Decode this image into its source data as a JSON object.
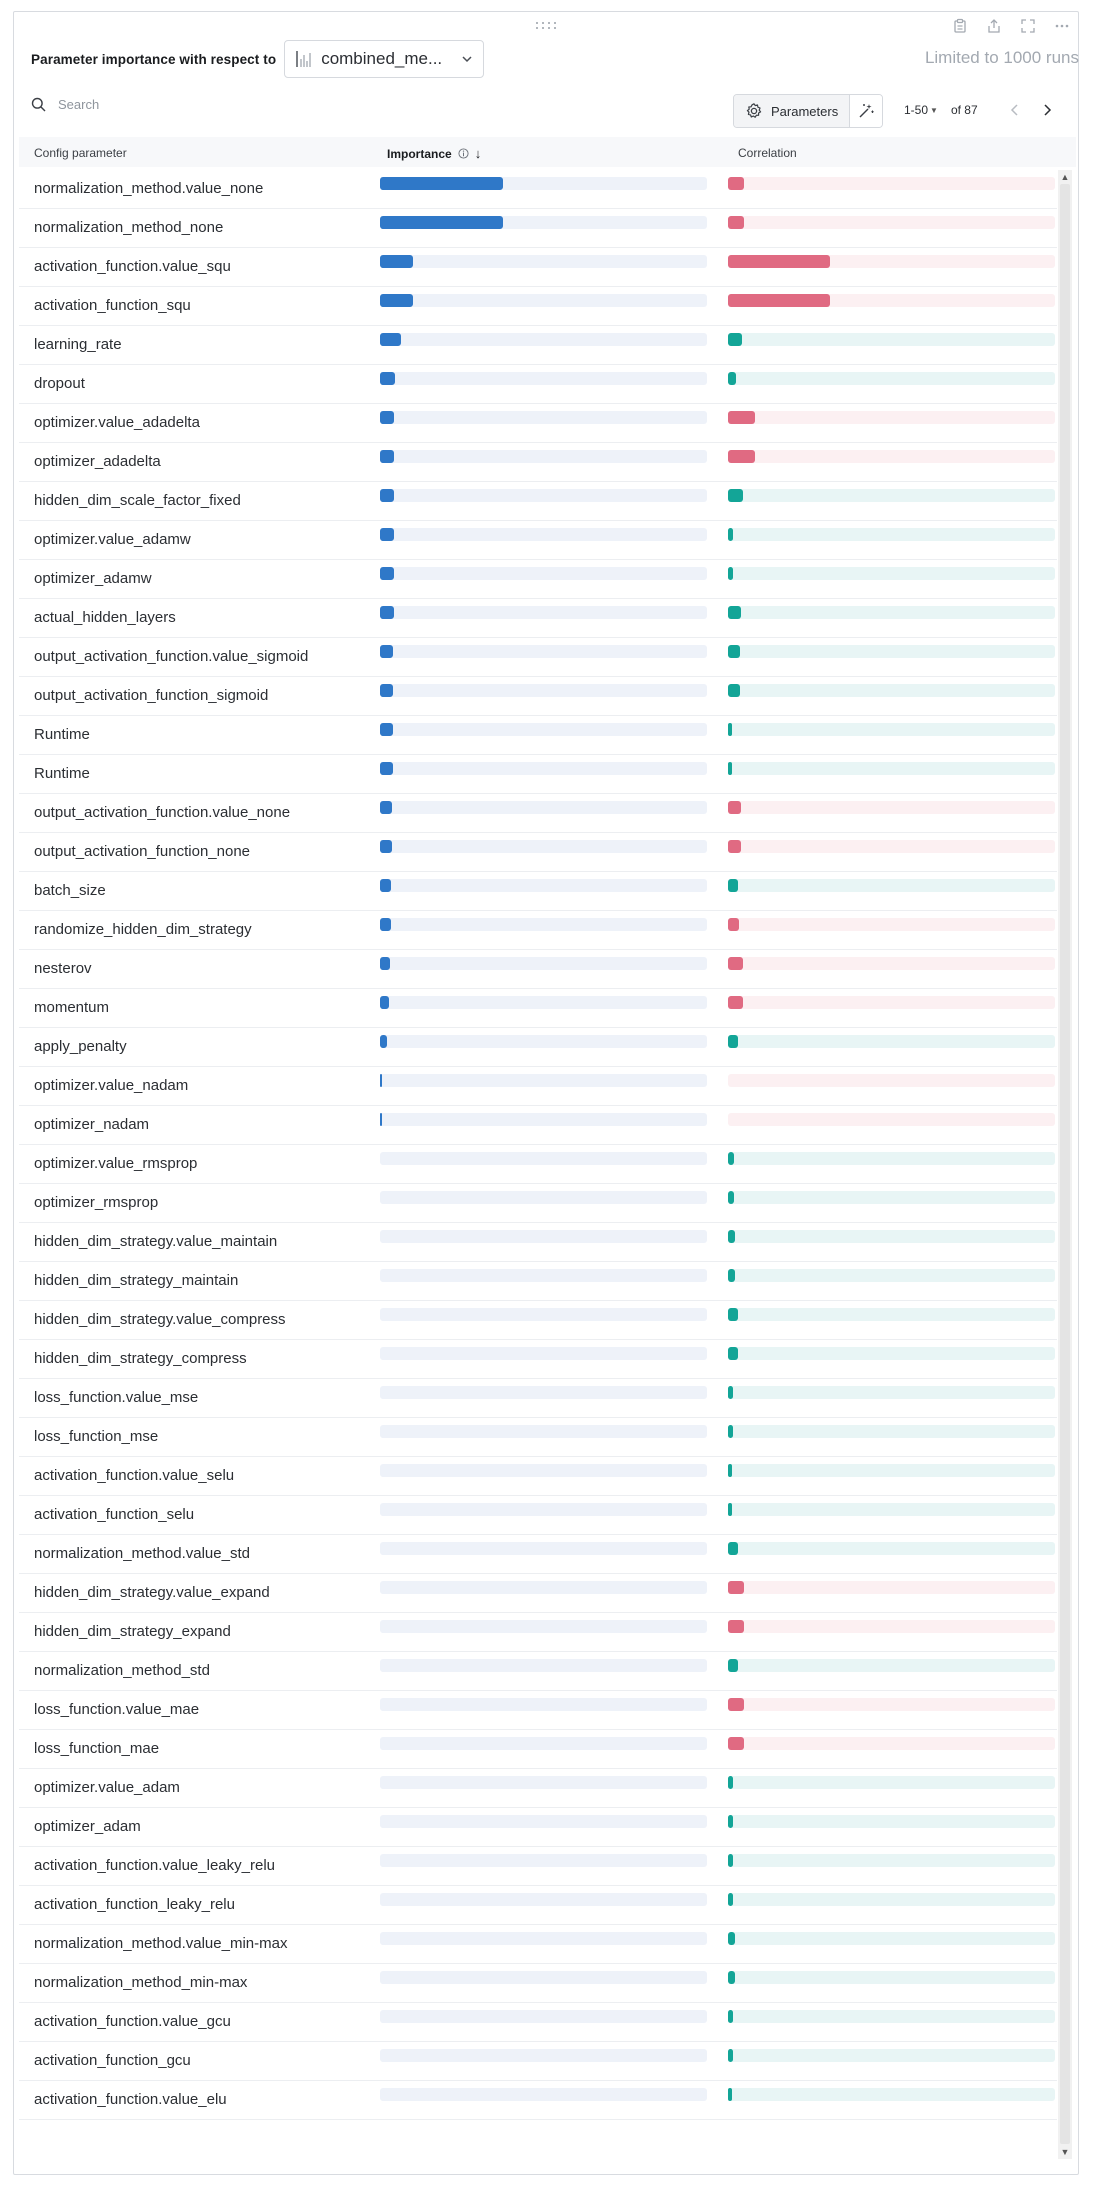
{
  "panel": {
    "title": "Parameter importance with respect to",
    "metric_select": {
      "value": "combined_me...",
      "icon": "bar-chart-icon"
    },
    "limit_text": "Limited to 1000 runs",
    "top_icons": [
      "clipboard-icon",
      "share-icon",
      "fullscreen-icon",
      "more-icon"
    ]
  },
  "toolbar": {
    "search_placeholder": "Search",
    "parameters_label": "Parameters",
    "page_range": "1-50",
    "page_of": "of 87"
  },
  "table": {
    "headers": {
      "config": "Config parameter",
      "importance": "Importance",
      "correlation": "Correlation"
    },
    "rows": [
      {
        "name": "normalization_method.value_none",
        "importance": 0.268,
        "correlation": -0.05
      },
      {
        "name": "normalization_method_none",
        "importance": 0.268,
        "correlation": -0.05
      },
      {
        "name": "activation_function.value_squ",
        "importance": 0.071,
        "correlation": -0.32
      },
      {
        "name": "activation_function_squ",
        "importance": 0.071,
        "correlation": -0.32
      },
      {
        "name": "learning_rate",
        "importance": 0.045,
        "correlation": 0.045
      },
      {
        "name": "dropout",
        "importance": 0.032,
        "correlation": 0.025
      },
      {
        "name": "optimizer.value_adadelta",
        "importance": 0.031,
        "correlation": -0.085
      },
      {
        "name": "optimizer_adadelta",
        "importance": 0.031,
        "correlation": -0.085
      },
      {
        "name": "hidden_dim_scale_factor_fixed",
        "importance": 0.031,
        "correlation": 0.048
      },
      {
        "name": "optimizer.value_adamw",
        "importance": 0.031,
        "correlation": 0.017
      },
      {
        "name": "optimizer_adamw",
        "importance": 0.031,
        "correlation": 0.017
      },
      {
        "name": "actual_hidden_layers",
        "importance": 0.03,
        "correlation": 0.041
      },
      {
        "name": "output_activation_function.value_sigmoid",
        "importance": 0.029,
        "correlation": 0.038
      },
      {
        "name": "output_activation_function_sigmoid",
        "importance": 0.029,
        "correlation": 0.038
      },
      {
        "name": "Runtime",
        "importance": 0.029,
        "correlation": 0.013
      },
      {
        "name": "Runtime",
        "importance": 0.029,
        "correlation": 0.013
      },
      {
        "name": "output_activation_function.value_none",
        "importance": 0.027,
        "correlation": -0.04
      },
      {
        "name": "output_activation_function_none",
        "importance": 0.027,
        "correlation": -0.04
      },
      {
        "name": "batch_size",
        "importance": 0.024,
        "correlation": 0.032
      },
      {
        "name": "randomize_hidden_dim_strategy",
        "importance": 0.024,
        "correlation": -0.035
      },
      {
        "name": "nesterov",
        "importance": 0.022,
        "correlation": -0.048
      },
      {
        "name": "momentum",
        "importance": 0.02,
        "correlation": -0.046
      },
      {
        "name": "apply_penalty",
        "importance": 0.016,
        "correlation": 0.031
      },
      {
        "name": "optimizer.value_nadam",
        "importance": 0.005,
        "correlation": 0.0
      },
      {
        "name": "optimizer_nadam",
        "importance": 0.005,
        "correlation": 0.0
      },
      {
        "name": "optimizer.value_rmsprop",
        "importance": 0.0,
        "correlation": 0.018
      },
      {
        "name": "optimizer_rmsprop",
        "importance": 0.0,
        "correlation": 0.018
      },
      {
        "name": "hidden_dim_strategy.value_maintain",
        "importance": 0.0,
        "correlation": 0.022
      },
      {
        "name": "hidden_dim_strategy_maintain",
        "importance": 0.0,
        "correlation": 0.022
      },
      {
        "name": "hidden_dim_strategy.value_compress",
        "importance": 0.0,
        "correlation": 0.032
      },
      {
        "name": "hidden_dim_strategy_compress",
        "importance": 0.0,
        "correlation": 0.032
      },
      {
        "name": "loss_function.value_mse",
        "importance": 0.0,
        "correlation": 0.017
      },
      {
        "name": "loss_function_mse",
        "importance": 0.0,
        "correlation": 0.017
      },
      {
        "name": "activation_function.value_selu",
        "importance": 0.0,
        "correlation": 0.013
      },
      {
        "name": "activation_function_selu",
        "importance": 0.0,
        "correlation": 0.013
      },
      {
        "name": "normalization_method.value_std",
        "importance": 0.0,
        "correlation": 0.031
      },
      {
        "name": "hidden_dim_strategy.value_expand",
        "importance": 0.0,
        "correlation": -0.05
      },
      {
        "name": "hidden_dim_strategy_expand",
        "importance": 0.0,
        "correlation": -0.05
      },
      {
        "name": "normalization_method_std",
        "importance": 0.0,
        "correlation": 0.031
      },
      {
        "name": "loss_function.value_mae",
        "importance": 0.0,
        "correlation": -0.05
      },
      {
        "name": "loss_function_mae",
        "importance": 0.0,
        "correlation": -0.05
      },
      {
        "name": "optimizer.value_adam",
        "importance": 0.0,
        "correlation": 0.017
      },
      {
        "name": "optimizer_adam",
        "importance": 0.0,
        "correlation": 0.017
      },
      {
        "name": "activation_function.value_leaky_relu",
        "importance": 0.0,
        "correlation": 0.017
      },
      {
        "name": "activation_function_leaky_relu",
        "importance": 0.0,
        "correlation": 0.017
      },
      {
        "name": "normalization_method.value_min-max",
        "importance": 0.0,
        "correlation": 0.022
      },
      {
        "name": "normalization_method_min-max",
        "importance": 0.0,
        "correlation": 0.022
      },
      {
        "name": "activation_function.value_gcu",
        "importance": 0.0,
        "correlation": 0.017
      },
      {
        "name": "activation_function_gcu",
        "importance": 0.0,
        "correlation": 0.017
      },
      {
        "name": "activation_function.value_elu",
        "importance": 0.0,
        "correlation": 0.013
      }
    ]
  },
  "colors": {
    "importance_bar": "#2f78c8",
    "importance_track": "#eef2f9",
    "positive_correlation": "#13a597",
    "positive_track": "#e8f5f5",
    "negative_correlation": "#e06a82",
    "negative_track": "#fcf0f2"
  }
}
